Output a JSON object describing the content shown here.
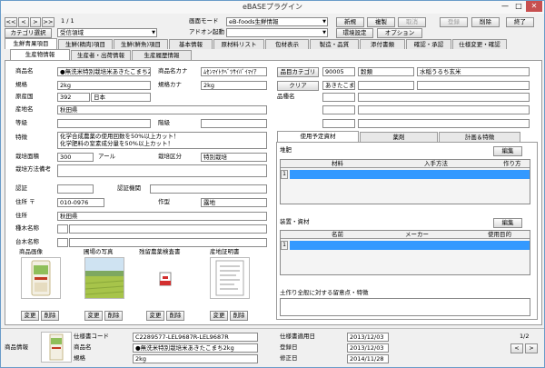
{
  "window": {
    "title": "eBASEプラグイン",
    "minimize": "—",
    "maximize": "□",
    "close": "✕"
  },
  "toolbar": {
    "nav_first": "<<",
    "nav_prev": "<",
    "nav_next": ">",
    "nav_last": ">>",
    "record_counter": "1 / 1",
    "screen_mode_label": "画面モード",
    "screen_mode_value": "eB-foods生鮮情報",
    "addon_label": "アドオン起動",
    "addon_value": "",
    "category_select_label": "カテゴリ選択",
    "category_value": "受信領域",
    "new_label": "新規",
    "copy_label": "複製",
    "cancel_label": "取消",
    "register_label": "登録",
    "delete_label": "削除",
    "exit_label": "終了",
    "env_label": "環境設定",
    "options_label": "オプション"
  },
  "main_tabs": [
    "生鮮青果項目",
    "生鮮(精肉)項目",
    "生鮮(鮮魚)項目",
    "基本情報",
    "原材料リスト",
    "包材表示",
    "製造・品質",
    "添付書類",
    "確認・承認",
    "仕様変更・確認"
  ],
  "sub_tabs": [
    "生産物情報",
    "生産者・出荷情報",
    "生産履歴情報"
  ],
  "product": {
    "name_label": "商品名",
    "name_value": "●無洗米特別栽培米あきたこまち2",
    "kana_label": "商品名カナ",
    "kana_value": "ﾑｾﾝﾏｲﾄｸﾍﾞﾂｻｲﾊﾞｲﾏｲｱ",
    "spec_label": "規格",
    "spec_value": "2kg",
    "spec_kana_label": "規格カナ",
    "spec_kana_value": "2kg",
    "origin_label": "原産国",
    "origin_code": "392",
    "origin_value": "日本",
    "place_label": "産地名",
    "place_value": "秋田県",
    "grade_label": "等級",
    "grade_value": "",
    "class_label": "階級",
    "class_value": "",
    "feature_label": "特徴",
    "feature_line1": "化学合成農薬の使用回数を50%以上カット！",
    "feature_line2": "化学肥料の窒素成分量を50%以上カット！",
    "area_label": "栽培面積",
    "area_value": "300",
    "area_unit": "アール",
    "cult_type_label": "栽培区分",
    "cult_type_value": "特別栽培",
    "method_label": "栽培方法備考",
    "method_value": "",
    "cert_label": "認証",
    "cert_value": "",
    "cert_org_label": "認証機関",
    "cert_org_value": "",
    "zip_label": "住所 〒",
    "zip_value": "010-0976",
    "crop_label": "作型",
    "crop_value": "露地",
    "address_label": "住所",
    "address_value": "秋田県",
    "seed_label": "種木名称",
    "seed_value": "",
    "root_label": "台木名称",
    "root_value": ""
  },
  "images": {
    "product_label": "商品画像",
    "field_label": "圃場の写真",
    "residue_label": "残留農薬検査書",
    "certificate_label": "産地証明書",
    "change_label": "変更",
    "delete_label": "削除"
  },
  "category": {
    "button_label": "品目カテゴリ",
    "code": "90005",
    "value1": "穀類",
    "value2": "水稲うるち玄米",
    "clear_label": "クリア",
    "sub_value": "あきたこまち",
    "variety_label": "品種名"
  },
  "material_tabs": [
    "使用予定資材",
    "薬剤",
    "計画＆特徴"
  ],
  "fertilizer": {
    "label": "堆肥",
    "edit_label": "編集",
    "columns": [
      "材料",
      "入手方法",
      "作り方"
    ],
    "row_number": "1"
  },
  "equipment": {
    "label": "装置・資材",
    "edit_label": "編集",
    "columns": [
      "名前",
      "メーカー",
      "使用目的"
    ],
    "row_number": "1"
  },
  "soil_label": "土作り全般に対する留意点・特徴",
  "status": {
    "product_info_label": "商品情報",
    "spec_code_label": "仕様書コード",
    "spec_code_value": "C2289577-LEL9687R-LEL9687R",
    "name_label": "商品名",
    "name_value": "●無洗米特別栽培米あきたこまち2kg",
    "spec_label": "規格",
    "spec_value": "2kg",
    "apply_date_label": "仕様書適用日",
    "apply_date_value": "2013/12/03",
    "register_date_label": "登録日",
    "register_date_value": "2013/12/03",
    "modify_date_label": "修正日",
    "modify_date_value": "2014/11/28",
    "page_value": "1/2",
    "prev": "<",
    "next": ">"
  },
  "colors": {
    "selection": "#3399ff",
    "window_border": "#6a9cc9"
  }
}
